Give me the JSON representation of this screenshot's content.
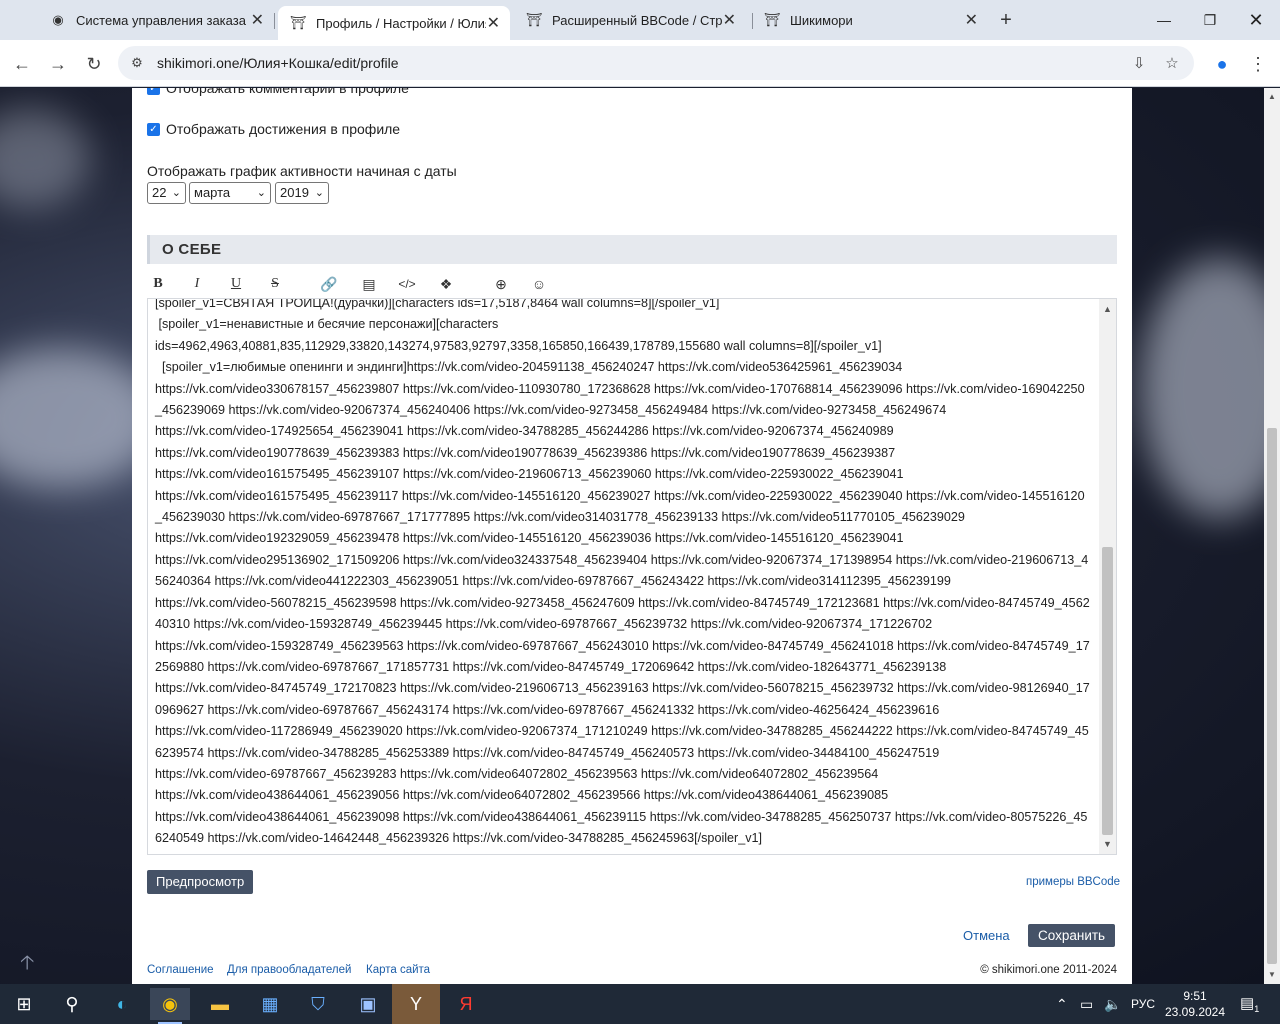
{
  "browser": {
    "tabs": [
      {
        "title": "Система управления заказами",
        "active": false
      },
      {
        "title": "Профиль / Настройки / Юлия",
        "active": true
      },
      {
        "title": "Расширенный BBCode / Стран",
        "active": false
      },
      {
        "title": "Шикимори",
        "active": false
      }
    ],
    "url": "shikimori.one/Юлия+Кошка/edit/profile"
  },
  "settings": {
    "checkbox_comments": "Отображать комментарии в профиле",
    "checkbox_achievements": "Отображать достижения в профиле",
    "activity_label": "Отображать график активности начиная с даты",
    "day": "22",
    "month": "марта",
    "year": "2019"
  },
  "about": {
    "section_title": "О СЕБЕ",
    "text": "[spoiler_v1=СВЯТАЯ ТРОИЦА!(дурачки)][characters ids=17,5187,8464 wall columns=8][/spoiler_v1]\n [spoiler_v1=ненавистные и бесячие персонажи][characters\nids=4962,4963,40881,835,112929,33820,143274,97583,92797,3358,165850,166439,178789,155680 wall columns=8][/spoiler_v1]\n  [spoiler_v1=любимые опенинги и эндинги]https://vk.com/video-204591138_456240247 https://vk.com/video536425961_456239034\nhttps://vk.com/video330678157_456239807 https://vk.com/video-110930780_172368628 https://vk.com/video-170768814_456239096 https://vk.com/video-169042250_456239069 https://vk.com/video-92067374_456240406 https://vk.com/video-9273458_456249484 https://vk.com/video-9273458_456249674\nhttps://vk.com/video-174925654_456239041 https://vk.com/video-34788285_456244286 https://vk.com/video-92067374_456240989\nhttps://vk.com/video190778639_456239383 https://vk.com/video190778639_456239386 https://vk.com/video190778639_456239387\nhttps://vk.com/video161575495_456239107 https://vk.com/video-219606713_456239060 https://vk.com/video-225930022_456239041\nhttps://vk.com/video161575495_456239117 https://vk.com/video-145516120_456239027 https://vk.com/video-225930022_456239040 https://vk.com/video-145516120_456239030 https://vk.com/video-69787667_171777895 https://vk.com/video314031778_456239133 https://vk.com/video511770105_456239029\nhttps://vk.com/video192329059_456239478 https://vk.com/video-145516120_456239036 https://vk.com/video-145516120_456239041\nhttps://vk.com/video295136902_171509206 https://vk.com/video324337548_456239404 https://vk.com/video-92067374_171398954 https://vk.com/video-219606713_456240364 https://vk.com/video441222303_456239051 https://vk.com/video-69787667_456243422 https://vk.com/video314112395_456239199\nhttps://vk.com/video-56078215_456239598 https://vk.com/video-9273458_456247609 https://vk.com/video-84745749_172123681 https://vk.com/video-84745749_456240310 https://vk.com/video-159328749_456239445 https://vk.com/video-69787667_456239732 https://vk.com/video-92067374_171226702\nhttps://vk.com/video-159328749_456239563 https://vk.com/video-69787667_456243010 https://vk.com/video-84745749_456241018 https://vk.com/video-84745749_172569880 https://vk.com/video-69787667_171857731 https://vk.com/video-84745749_172069642 https://vk.com/video-182643771_456239138\nhttps://vk.com/video-84745749_172170823 https://vk.com/video-219606713_456239163 https://vk.com/video-56078215_456239732 https://vk.com/video-98126940_170969627 https://vk.com/video-69787667_456243174 https://vk.com/video-69787667_456241332 https://vk.com/video-46256424_456239616\nhttps://vk.com/video-117286949_456239020 https://vk.com/video-92067374_171210249 https://vk.com/video-34788285_456244222 https://vk.com/video-84745749_456239574 https://vk.com/video-34788285_456253389 https://vk.com/video-84745749_456240573 https://vk.com/video-34484100_456247519\nhttps://vk.com/video-69787667_456239283 https://vk.com/video64072802_456239563 https://vk.com/video64072802_456239564\nhttps://vk.com/video438644061_456239056 https://vk.com/video64072802_456239566 https://vk.com/video438644061_456239085\nhttps://vk.com/video438644061_456239098 https://vk.com/video438644061_456239115 https://vk.com/video-34788285_456250737 https://vk.com/video-80575226_456240549 https://vk.com/video-14642448_456239326 https://vk.com/video-34788285_456245963[/spoiler_v1]"
  },
  "actions": {
    "preview": "Предпросмотр",
    "bbcode_examples": "примеры BBCode",
    "cancel": "Отмена",
    "save": "Сохранить"
  },
  "footer": {
    "agreement": "Соглашение",
    "rights": "Для правообладателей",
    "sitemap": "Карта сайта",
    "copyright": "© shikimori.one 2011-2024"
  },
  "taskbar": {
    "lang": "РУС",
    "time": "9:51",
    "date": "23.09.2024",
    "notifications": "1"
  },
  "colors": {
    "button_dark": "#455267",
    "link": "#1b5da8",
    "checkbox": "#1a73e8"
  }
}
